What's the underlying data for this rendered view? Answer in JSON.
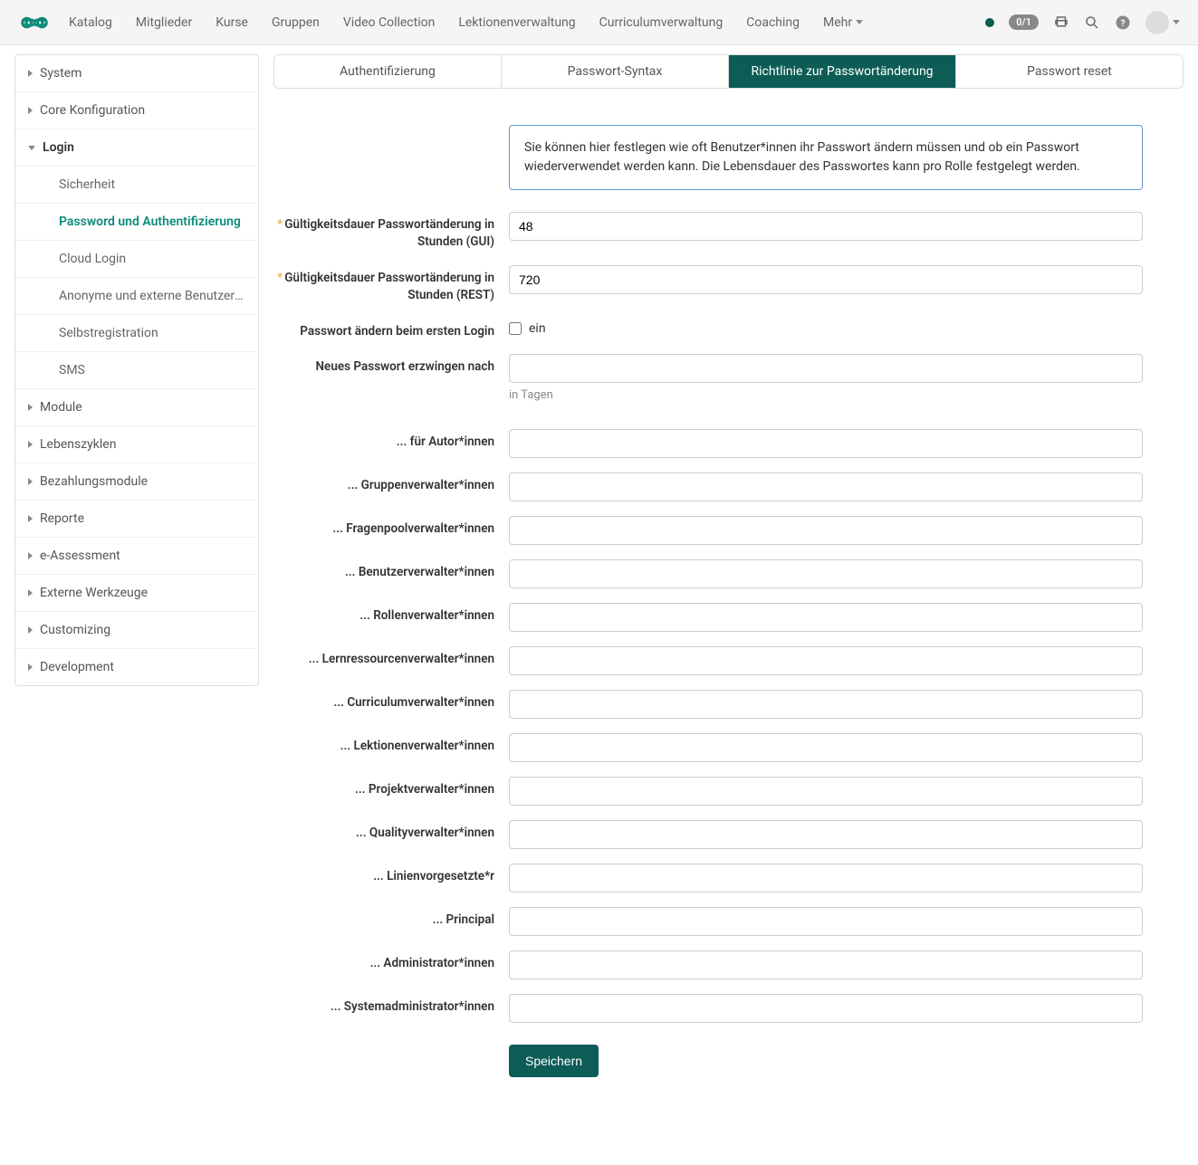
{
  "topnav": {
    "links": [
      "Katalog",
      "Mitglieder",
      "Kurse",
      "Gruppen",
      "Video Collection",
      "Lektionenverwaltung",
      "Curriculumverwaltung",
      "Coaching"
    ],
    "more": "Mehr",
    "badge": "0/1"
  },
  "sidebar": {
    "items": [
      {
        "label": "System",
        "expanded": false
      },
      {
        "label": "Core Konfiguration",
        "expanded": false
      },
      {
        "label": "Login",
        "expanded": true,
        "children": [
          {
            "label": "Sicherheit",
            "active": false
          },
          {
            "label": "Password und Authentifizierung",
            "active": true
          },
          {
            "label": "Cloud Login",
            "active": false
          },
          {
            "label": "Anonyme und externe Benutzer*innen",
            "active": false
          },
          {
            "label": "Selbstregistration",
            "active": false
          },
          {
            "label": "SMS",
            "active": false
          }
        ]
      },
      {
        "label": "Module",
        "expanded": false
      },
      {
        "label": "Lebenszyklen",
        "expanded": false
      },
      {
        "label": "Bezahlungsmodule",
        "expanded": false
      },
      {
        "label": "Reporte",
        "expanded": false
      },
      {
        "label": "e-Assessment",
        "expanded": false
      },
      {
        "label": "Externe Werkzeuge",
        "expanded": false
      },
      {
        "label": "Customizing",
        "expanded": false
      },
      {
        "label": "Development",
        "expanded": false
      }
    ]
  },
  "tabs": [
    {
      "label": "Authentifizierung",
      "active": false
    },
    {
      "label": "Passwort-Syntax",
      "active": false
    },
    {
      "label": "Richtlinie zur Passwortänderung",
      "active": true
    },
    {
      "label": "Passwort reset",
      "active": false
    }
  ],
  "info": "Sie können hier festlegen wie oft Benutzer*innen ihr Passwort ändern müssen und ob ein Passwort wiederverwendet werden kann. Die Lebensdauer des Passwortes kann pro Rolle festgelegt werden.",
  "fields": {
    "validity_gui": {
      "label": "Gültigkeitsdauer Passwortänderung in Stunden (GUI)",
      "value": "48",
      "required": true
    },
    "validity_rest": {
      "label": "Gültigkeitsdauer Passwortänderung in Stunden (REST)",
      "value": "720",
      "required": true
    },
    "change_first_login": {
      "label": "Passwort ändern beim ersten Login",
      "checkbox_label": "ein",
      "checked": false
    },
    "force_after": {
      "label": "Neues Passwort erzwingen nach",
      "value": "",
      "hint": "in Tagen"
    }
  },
  "role_fields": [
    {
      "label": "... für Autor*innen",
      "value": ""
    },
    {
      "label": "... Gruppenverwalter*innen",
      "value": ""
    },
    {
      "label": "... Fragenpoolverwalter*innen",
      "value": ""
    },
    {
      "label": "... Benutzerverwalter*innen",
      "value": ""
    },
    {
      "label": "... Rollenverwalter*innen",
      "value": ""
    },
    {
      "label": "... Lernressourcenverwalter*innen",
      "value": ""
    },
    {
      "label": "... Curriculumverwalter*innen",
      "value": ""
    },
    {
      "label": "... Lektionenverwalter*innen",
      "value": ""
    },
    {
      "label": "... Projektverwalter*innen",
      "value": ""
    },
    {
      "label": "... Qualityverwalter*innen",
      "value": ""
    },
    {
      "label": "... Linienvorgesetzte*r",
      "value": ""
    },
    {
      "label": "... Principal",
      "value": ""
    },
    {
      "label": "... Administrator*innen",
      "value": ""
    },
    {
      "label": "... Systemadministrator*innen",
      "value": ""
    }
  ],
  "save_label": "Speichern"
}
